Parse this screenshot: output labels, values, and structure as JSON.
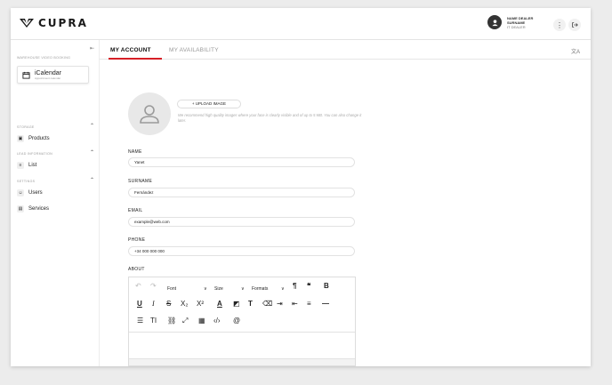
{
  "brand": {
    "name": "CUPRA"
  },
  "user": {
    "name_line1": "NAME DEALER",
    "name_line2": "SURNAME",
    "role": "IT DEALER"
  },
  "sidebar": {
    "top_heading": "WAREHOUSE VIDEO BOOKING",
    "calendar_card": {
      "title": "iCalendar",
      "subtitle": "Appointment calendar"
    },
    "sections": [
      {
        "heading": "STORAGE",
        "items": [
          {
            "label": "Products",
            "icon": "products-icon"
          }
        ]
      },
      {
        "heading": "LEAD INFORMATION",
        "items": [
          {
            "label": "List",
            "icon": "list-icon"
          }
        ]
      },
      {
        "heading": "SETTINGS",
        "items": [
          {
            "label": "Users",
            "icon": "users-icon"
          },
          {
            "label": "Services",
            "icon": "services-icon"
          }
        ]
      }
    ]
  },
  "tabs": {
    "active": "MY ACCOUNT",
    "inactive": "MY AVAILABILITY"
  },
  "profile": {
    "upload_label": "+ UPLOAD IMAGE",
    "upload_hint": "We recommend high quality images where your face is clearly visible and of up to 5 MB. You can also change it later."
  },
  "form": {
    "name_label": "NAME",
    "name_value": "Yanet",
    "surname_label": "SURNAME",
    "surname_value": "Fernández",
    "email_label": "EMAIL",
    "email_value": "example@web.com",
    "phone_label": "PHONE",
    "phone_value": "+34 000 000 000",
    "about_label": "ABOUT"
  },
  "editor": {
    "font_label": "Font",
    "size_label": "Size",
    "formats_label": "Formats"
  },
  "colors": {
    "accent": "#d61f26",
    "text": "#222222",
    "muted": "#999999"
  }
}
